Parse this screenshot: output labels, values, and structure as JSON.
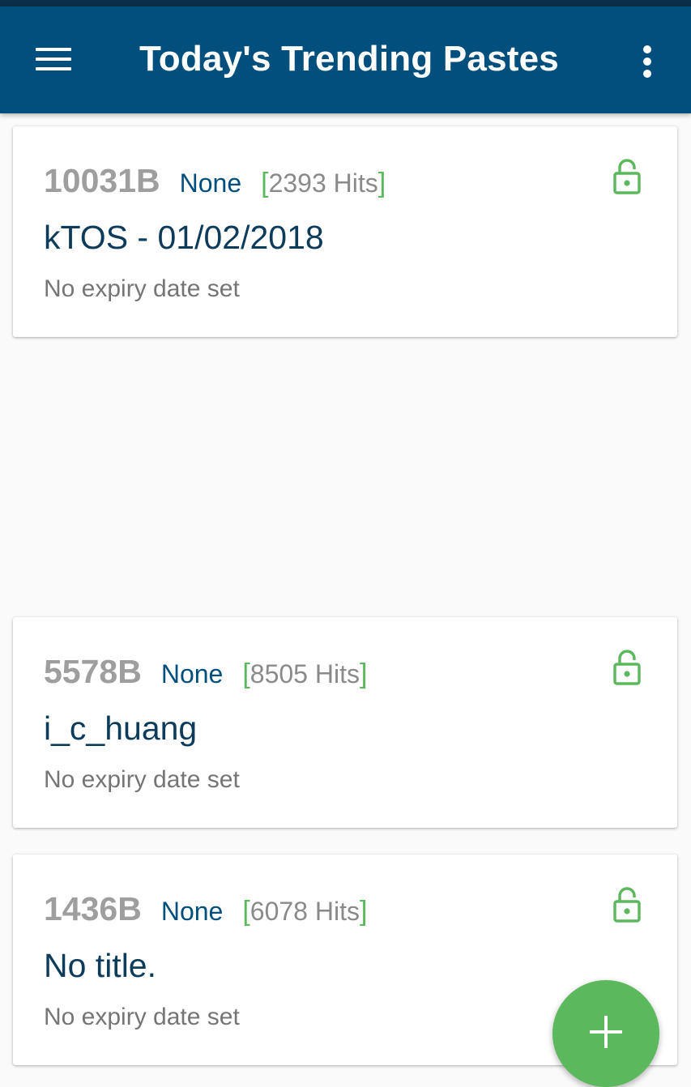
{
  "app_bar": {
    "title": "Today's Trending Pastes",
    "background_color": "#004f7d",
    "menu_icon": "hamburger-menu-icon",
    "overflow_icon": "more-vert-icon"
  },
  "pastes": [
    {
      "size": "10031B",
      "syntax": "None",
      "hits": "2393 Hits",
      "title": "kTOS - 01/02/2018",
      "expiry": "No expiry date set",
      "visibility_icon": "unlocked-padlock-icon"
    },
    {
      "size": "5578B",
      "syntax": "None",
      "hits": "8505 Hits",
      "title": "i_c_huang",
      "expiry": "No expiry date set",
      "visibility_icon": "unlocked-padlock-icon"
    },
    {
      "size": "1436B",
      "syntax": "None",
      "hits": "6078 Hits",
      "title": "No title.",
      "expiry": "No expiry date set",
      "visibility_icon": "unlocked-padlock-icon"
    }
  ],
  "fab": {
    "icon": "plus-icon",
    "color": "#5cb85c"
  },
  "colors": {
    "accent_green": "#5cb85c",
    "syntax_blue": "#004f7d",
    "title_blue": "#0d3c5a"
  }
}
